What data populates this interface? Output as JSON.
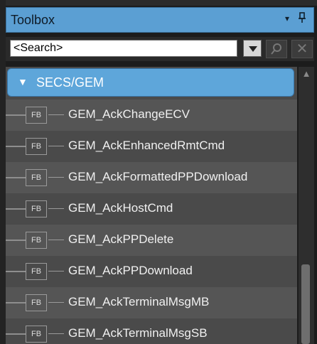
{
  "panel": {
    "title": "Toolbox",
    "dropdown_icon": "▾",
    "pin_icon": "pin-icon"
  },
  "search": {
    "value": "<Search>",
    "clear_label": "✕"
  },
  "group": {
    "label": "SECS/GEM",
    "arrow": "▼"
  },
  "items": [
    {
      "badge": "FB",
      "name": "GEM_AckChangeECV"
    },
    {
      "badge": "FB",
      "name": "GEM_AckEnhancedRmtCmd"
    },
    {
      "badge": "FB",
      "name": "GEM_AckFormattedPPDownload"
    },
    {
      "badge": "FB",
      "name": "GEM_AckHostCmd"
    },
    {
      "badge": "FB",
      "name": "GEM_AckPPDelete"
    },
    {
      "badge": "FB",
      "name": "GEM_AckPPDownload"
    },
    {
      "badge": "FB",
      "name": "GEM_AckTerminalMsgMB"
    },
    {
      "badge": "FB",
      "name": "GEM_AckTerminalMsgSB"
    }
  ],
  "colors": {
    "titlebar": "#5b9fd3",
    "group_header": "#5ea6da",
    "list_bg": "#4a4a4a",
    "list_alt_bg": "#555555"
  }
}
